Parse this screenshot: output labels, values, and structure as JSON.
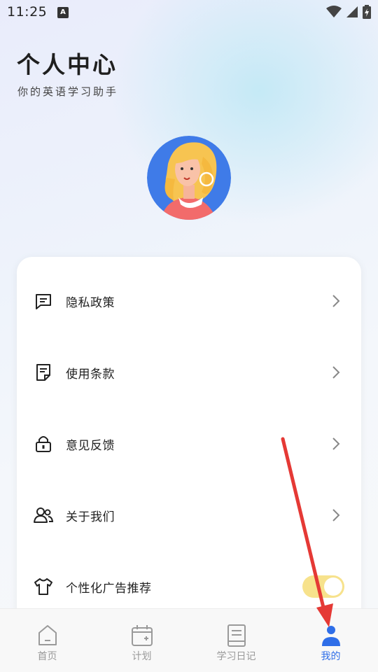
{
  "status_bar": {
    "time": "11:25",
    "notification_letter": "A"
  },
  "header": {
    "title": "个人中心",
    "subtitle": "你的英语学习助手"
  },
  "menu": {
    "items": [
      {
        "label": "隐私政策",
        "icon": "chat-text-icon"
      },
      {
        "label": "使用条款",
        "icon": "document-icon"
      },
      {
        "label": "意见反馈",
        "icon": "lock-icon"
      },
      {
        "label": "关于我们",
        "icon": "users-icon"
      },
      {
        "label": "个性化广告推荐",
        "icon": "tshirt-icon",
        "toggle": true
      }
    ]
  },
  "bottom_nav": {
    "items": [
      {
        "label": "首页",
        "icon": "home-icon"
      },
      {
        "label": "计划",
        "icon": "calendar-icon"
      },
      {
        "label": "学习日记",
        "icon": "book-icon"
      },
      {
        "label": "我的",
        "icon": "profile-icon",
        "active": true
      }
    ]
  },
  "colors": {
    "accent": "#2f6ee8",
    "toggle_on": "#f7e28c",
    "arrow": "#e53935"
  }
}
